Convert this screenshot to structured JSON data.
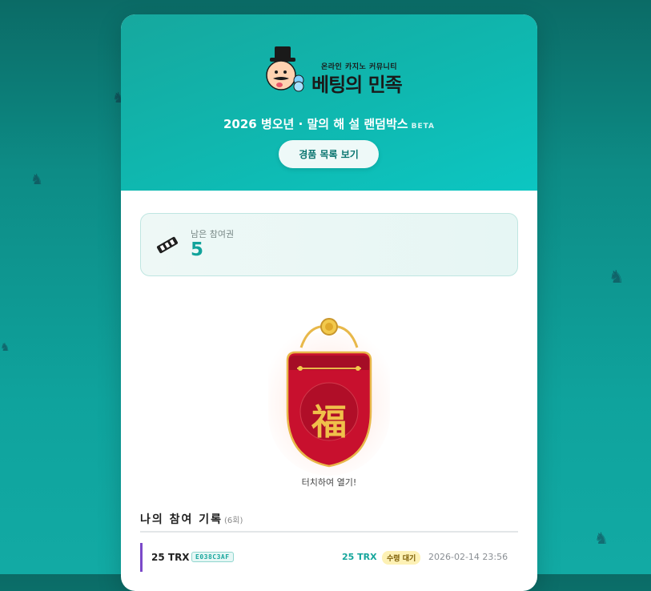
{
  "logo": {
    "subtitle": "온라인 카지노 커뮤니티",
    "name": "베팅의 민족"
  },
  "event": {
    "title": "2026 병오년 · 말의 해 설 랜덤박스",
    "badge": "BETA"
  },
  "prize_list_button": "경품 목록 보기",
  "tickets": {
    "label": "남은 참여권",
    "count": "5"
  },
  "bag": {
    "character": "福",
    "tap_text": "터치하여 열기!"
  },
  "history": {
    "title": "나의 참여 기록",
    "count": "(6회)",
    "rows": [
      {
        "amount": "25 TRX",
        "code": "E038C3AF",
        "amount_right": "25 TRX",
        "status": "수령 대기",
        "date": "2026-02-14 23:56"
      }
    ]
  },
  "colors": {
    "accent": "#11a39b",
    "bag_red": "#c8102e",
    "gold": "#e8b84a",
    "row_bar": "#7b49c9"
  }
}
